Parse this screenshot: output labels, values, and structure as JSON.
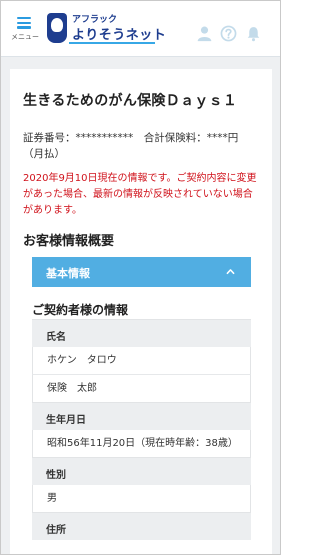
{
  "header": {
    "menu_label": "メニュー",
    "logo_small": "アフラック",
    "logo_big": "よりそうネット",
    "icons": [
      "person-icon",
      "help-icon",
      "bell-icon"
    ],
    "icon_color": "#c3dbea",
    "accent_color": "#2b9be0",
    "brand_color": "#1e3d8f"
  },
  "policy": {
    "title": "生きるためのがん保険Ｄａｙｓ１",
    "line": "証券番号：***********　合計保険料：****円（月払）"
  },
  "notice": "2020年9月10日現在の情報です。ご契約内容に変更があった場合、最新の情報が反映されていない場合があります。",
  "notice_color": "#d0121b",
  "customer": {
    "heading": "お客様情報概要",
    "accordion_label": "基本情報",
    "accordion_color": "#51aee2",
    "subheading": "ご契約者様の情報",
    "rows": [
      {
        "label": "氏名",
        "values": [
          "ホケン　タロウ",
          "保険　太郎"
        ]
      },
      {
        "label": "生年月日",
        "values": [
          "昭和56年11月20日（現在時年齢：38歳）"
        ]
      },
      {
        "label": "性別",
        "values": [
          "男"
        ]
      },
      {
        "label": "住所",
        "values": []
      }
    ]
  }
}
